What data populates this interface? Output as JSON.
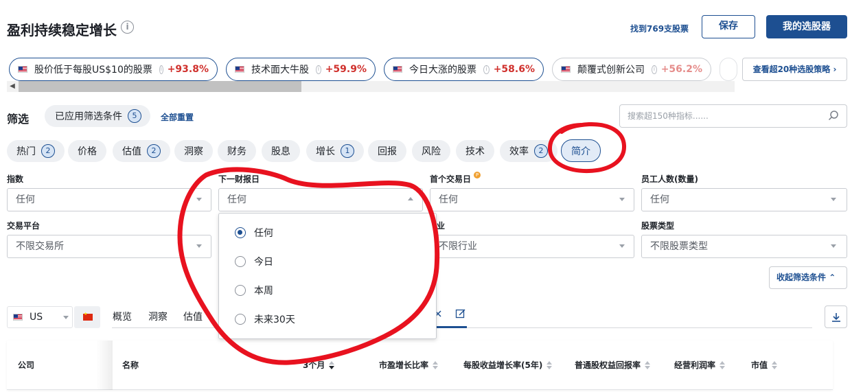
{
  "header": {
    "title": "盈利持续稳定增长",
    "found_text": "找到769支股票",
    "save_label": "保存",
    "my_screeners_label": "我的选股器"
  },
  "strategies": [
    {
      "name": "股价低于每股US$10的股票",
      "pct": "+93.8%"
    },
    {
      "name": "技术面大牛股",
      "pct": "+59.9%"
    },
    {
      "name": "今日大涨的股票",
      "pct": "+58.6%"
    },
    {
      "name": "颠覆式创新公司",
      "pct": "+56.2%"
    }
  ],
  "see_more_label": "查看超20种选股策略",
  "filter": {
    "label": "筛选",
    "applied_label": "已应用筛选条件",
    "applied_count": "5",
    "reset_label": "全部重置",
    "search_placeholder": "搜索超150种指标......"
  },
  "categories": [
    {
      "label": "热门",
      "count": "2"
    },
    {
      "label": "价格",
      "count": ""
    },
    {
      "label": "估值",
      "count": "2"
    },
    {
      "label": "洞察",
      "count": ""
    },
    {
      "label": "财务",
      "count": ""
    },
    {
      "label": "股息",
      "count": ""
    },
    {
      "label": "增长",
      "count": "1"
    },
    {
      "label": "回报",
      "count": ""
    },
    {
      "label": "风险",
      "count": ""
    },
    {
      "label": "技术",
      "count": ""
    },
    {
      "label": "效率",
      "count": "2"
    },
    {
      "label": "简介",
      "count": ""
    }
  ],
  "fields": {
    "index": {
      "label": "指数",
      "value": "任何"
    },
    "next_earnings": {
      "label": "下一财报日",
      "value": "任何"
    },
    "first_trade": {
      "label": "首个交易日",
      "value": "任何"
    },
    "employees": {
      "label": "员工人数(数量)",
      "value": "任何"
    },
    "exchange": {
      "label": "交易平台",
      "value": "不限交易所"
    },
    "industry": {
      "label": "业",
      "value": "不限行业"
    },
    "stock_type": {
      "label": "股票类型",
      "value": "不限股票类型"
    }
  },
  "dropdown_options": [
    "任何",
    "今日",
    "本周",
    "未来30天"
  ],
  "dropdown_selected": "任何",
  "collapse_label": "收起筛选条件",
  "market": {
    "selected": "US"
  },
  "result_tabs": [
    "概览",
    "洞察",
    "估值"
  ],
  "table_headers": {
    "company": "公司",
    "name": "名称",
    "three_month": "3个月",
    "peg": "市盈增长比率",
    "eps_growth": "每股收益增长率(5年)",
    "roe": "普通股权益回报率",
    "op_margin": "经营利润率",
    "market_cap": "市值"
  },
  "colors": {
    "brand": "#1d4f91",
    "positive": "#d0312d",
    "annotation": "#e8121f"
  }
}
